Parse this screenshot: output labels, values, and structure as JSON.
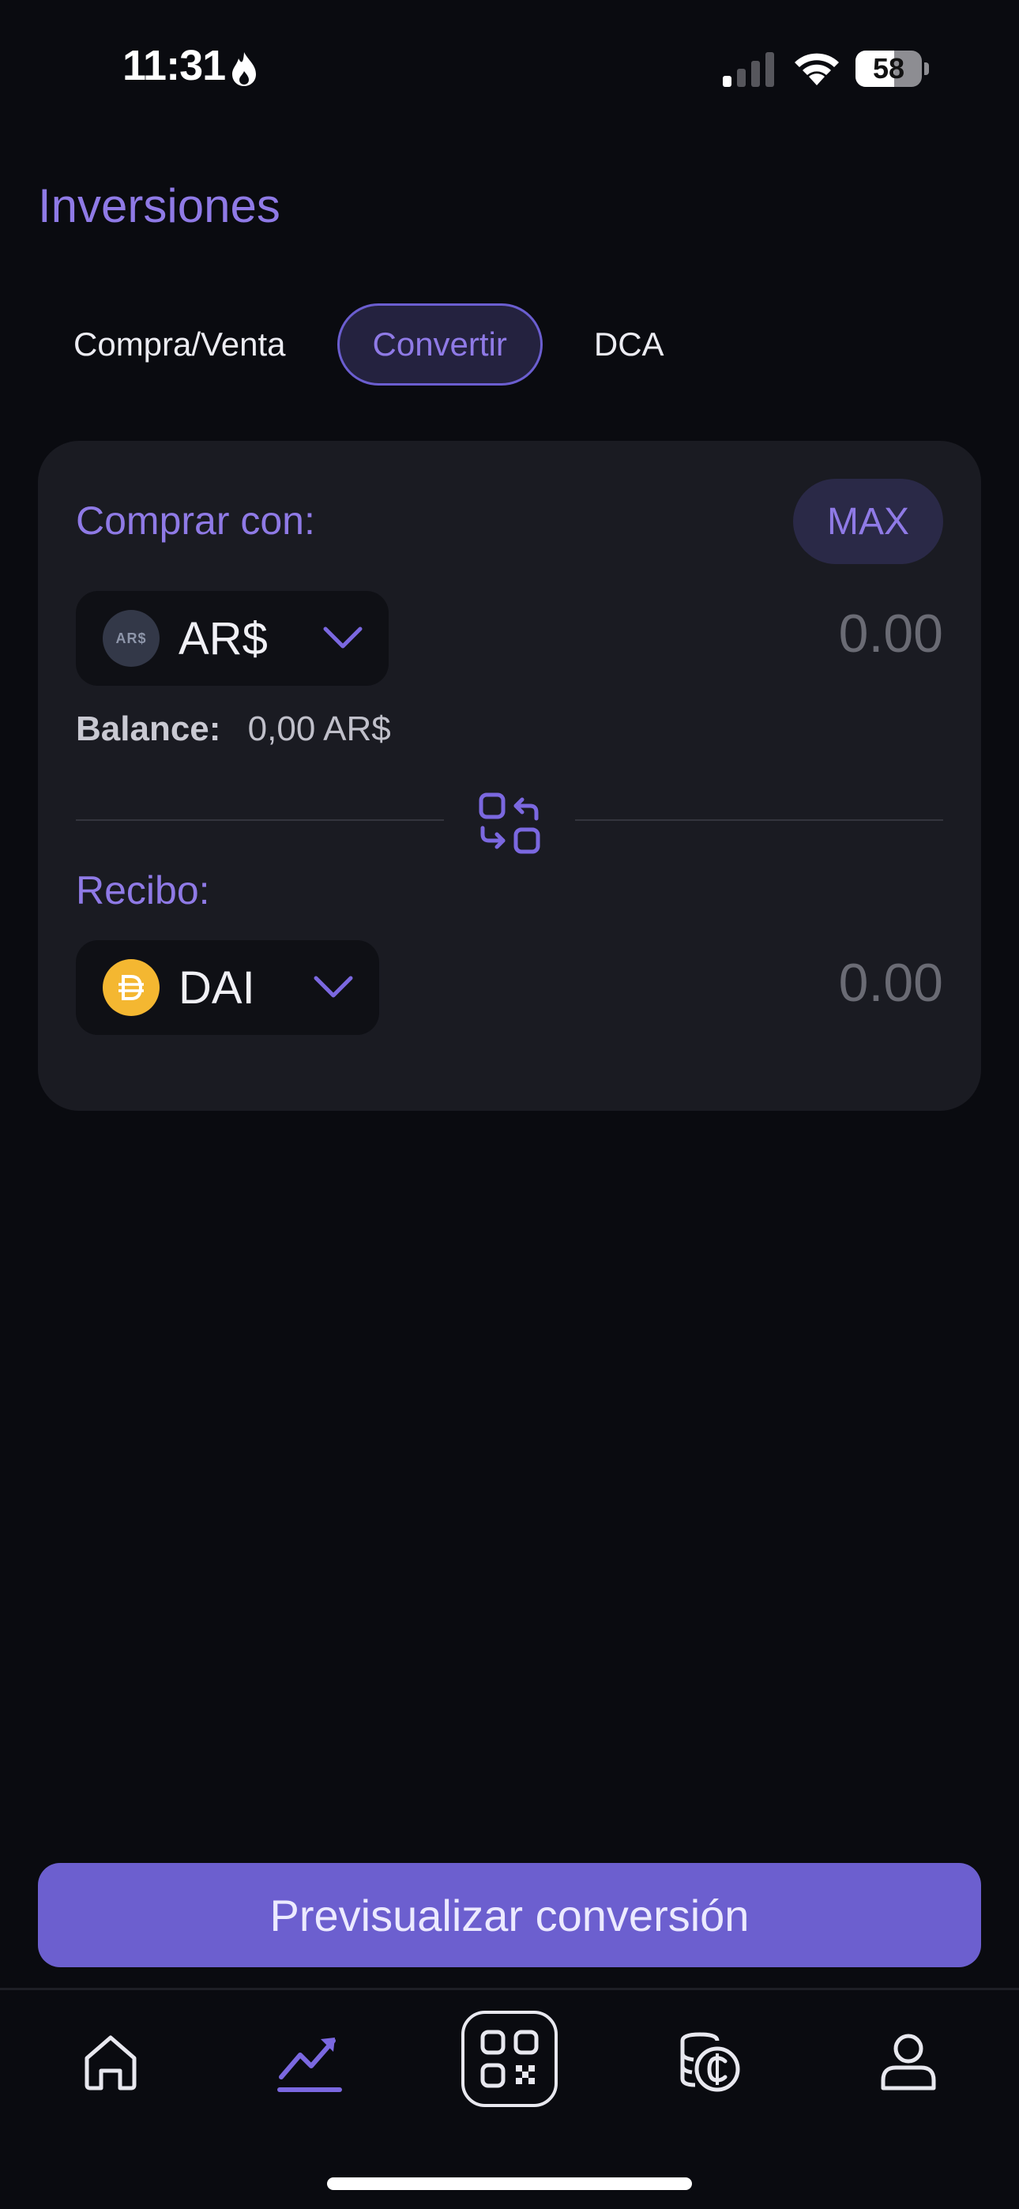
{
  "status_bar": {
    "time": "11:31",
    "battery_level": "58",
    "battery_fraction": 0.58
  },
  "page": {
    "title": "Inversiones"
  },
  "tabs": [
    {
      "label": "Compra/Venta",
      "active": false
    },
    {
      "label": "Convertir",
      "active": true
    },
    {
      "label": "DCA",
      "active": false
    }
  ],
  "from": {
    "label": "Comprar con:",
    "max_label": "MAX",
    "asset_logo_text": "AR$",
    "asset_code": "AR$",
    "amount_placeholder": "0.00",
    "balance_label": "Balance:",
    "balance_value": "0,00 AR$"
  },
  "to": {
    "label": "Recibo:",
    "asset_code": "DAI",
    "amount_placeholder": "0.00"
  },
  "cta": {
    "label": "Previsualizar conversión"
  },
  "nav": {
    "items": [
      {
        "name": "home",
        "icon": "home-icon",
        "active": false
      },
      {
        "name": "investments",
        "icon": "chart-trend-icon",
        "active": true
      },
      {
        "name": "scan",
        "icon": "qr-code-icon",
        "active": false
      },
      {
        "name": "coins",
        "icon": "coins-icon",
        "active": false
      },
      {
        "name": "profile",
        "icon": "user-icon",
        "active": false
      }
    ]
  },
  "colors": {
    "accent": "#8f7ae6",
    "button": "#6c5fcf",
    "background": "#0a0b10",
    "card": "#1a1b22",
    "dai": "#f4b731"
  }
}
